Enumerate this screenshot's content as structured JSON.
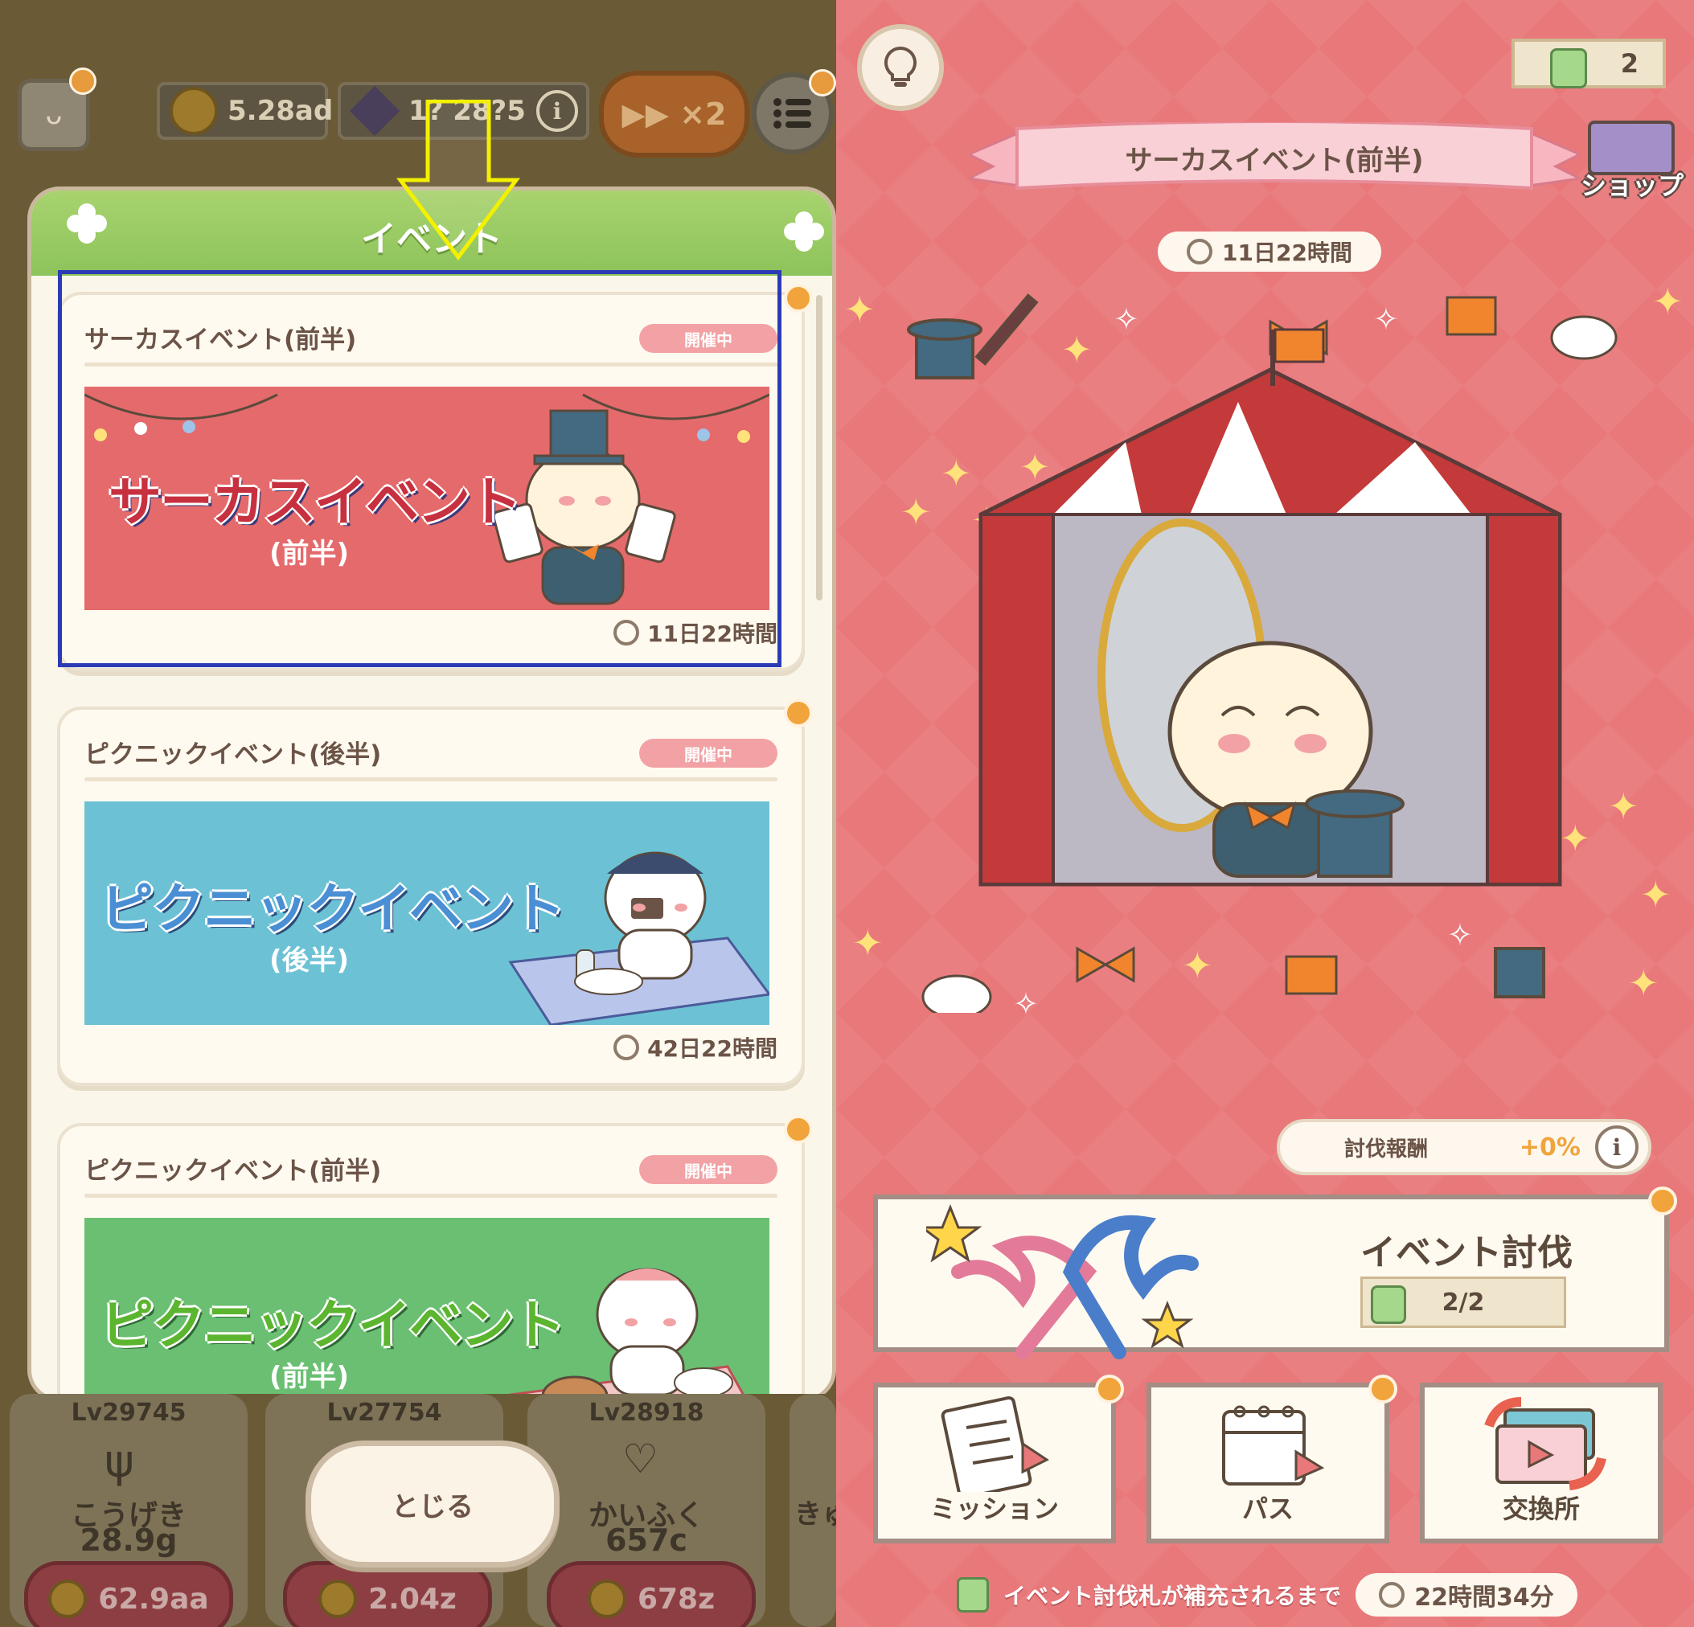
{
  "left": {
    "hud": {
      "coins": "5.28ad",
      "gems": "1? 28?5",
      "speed": "▶▶ ×2"
    },
    "modal": {
      "title": "イベント",
      "events": [
        {
          "title": "サーカスイベント(前半)",
          "status": "開催中",
          "banner_title": "サーカスイベント",
          "banner_sub": "(前半)",
          "time_left": "11日22時間",
          "banner_color": "#e46a6c"
        },
        {
          "title": "ピクニックイベント(後半)",
          "status": "開催中",
          "banner_title": "ピクニックイベント",
          "banner_sub": "(後半)",
          "time_left": "42日22時間",
          "banner_color": "#6cc2d4"
        },
        {
          "title": "ピクニックイベント(前半)",
          "status": "開催中",
          "banner_title": "ピクニックイベント",
          "banner_sub": "(前半)",
          "time_left": "",
          "banner_color": "#6abf72"
        }
      ]
    },
    "close_button": "とじる",
    "upgrades": [
      {
        "level": "Lv29745",
        "name": "こうげき",
        "value": "28.9g",
        "cost": "62.9aa"
      },
      {
        "level": "Lv27754",
        "name": "",
        "value": "",
        "cost": "2.04z"
      },
      {
        "level": "Lv28918",
        "name": "かいふく",
        "value": "657c",
        "cost": "678z"
      },
      {
        "level": "",
        "name": "きゅ",
        "value": "",
        "cost": ""
      }
    ],
    "annotation_colors": {
      "highlight_box": "#2b3bb5",
      "arrow": "#f3f000"
    }
  },
  "right": {
    "tickets": "2",
    "event_name": "サーカスイベント(前半)",
    "shop_label": "ショップ",
    "time_left": "11日22時間",
    "reward_label": "討伐報酬",
    "reward_value": "+0%",
    "raid_title": "イベント討伐",
    "raid_count": "2/2",
    "menu": [
      {
        "label": "ミッション",
        "icon": "clipboard-icon"
      },
      {
        "label": "パス",
        "icon": "calendar-icon"
      },
      {
        "label": "交換所",
        "icon": "exchange-icon"
      }
    ],
    "refill_text": "イベント討伐札が補充されるまで",
    "refill_timer": "22時間34分",
    "bg_color": "#e8787a"
  }
}
